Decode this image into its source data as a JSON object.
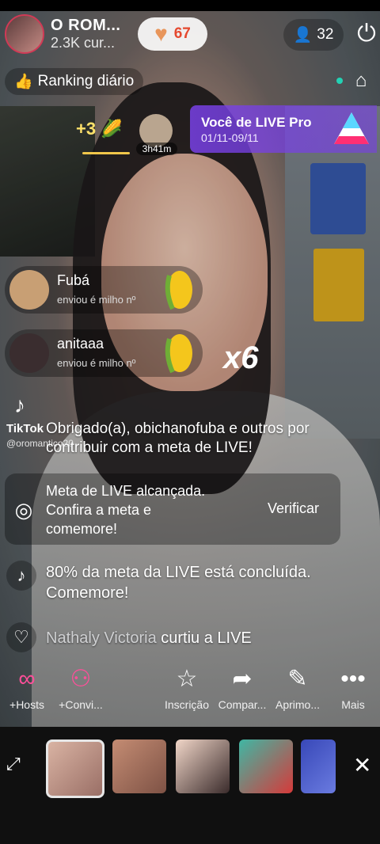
{
  "header": {
    "host_name": "O ROM...",
    "host_sub": "2.3K cur...",
    "likes": "67",
    "viewers": "32"
  },
  "ranking": {
    "label": "Ranking diário"
  },
  "booster": {
    "count": "+3",
    "time": "3h41m"
  },
  "pro_card": {
    "title": "Você de LIVE Pro",
    "dates": "01/11-09/11"
  },
  "gifts": [
    {
      "name": "Fubá",
      "sub": "enviou é milho nº"
    },
    {
      "name": "anitaaa",
      "sub": "enviou é milho nº"
    }
  ],
  "combo": "x6",
  "watermark": {
    "brand": "TikTok",
    "handle": "@oromantico20"
  },
  "chat": {
    "thanks_line1": "Obrigado(a), obichanofuba e outros por",
    "thanks_line2": "contribuir com a meta de LIVE!",
    "goal_line1": "Meta de LIVE alcançada.",
    "goal_line2": "Confira a meta e",
    "goal_line3": "comemore!",
    "goal_button": "Verificar",
    "progress_line1": "80% da meta da LIVE está concluída.",
    "progress_line2": "Comemore!",
    "like_user": "Nathaly Victoria",
    "like_text": " curtiu a LIVE"
  },
  "toolbar": [
    {
      "label": "+Hosts",
      "icon": "hosts-icon"
    },
    {
      "label": "+Convi...",
      "icon": "invite-icon"
    },
    {
      "label": "Inscrição",
      "icon": "subscribe-icon"
    },
    {
      "label": "Compar...",
      "icon": "share-icon"
    },
    {
      "label": "Aprimo...",
      "icon": "enhance-icon"
    },
    {
      "label": "Mais",
      "icon": "more-icon"
    }
  ],
  "colors": {
    "accent_purple": "#7840e6",
    "like_orange": "#e8955a",
    "online_dot": "#23d2b4"
  }
}
